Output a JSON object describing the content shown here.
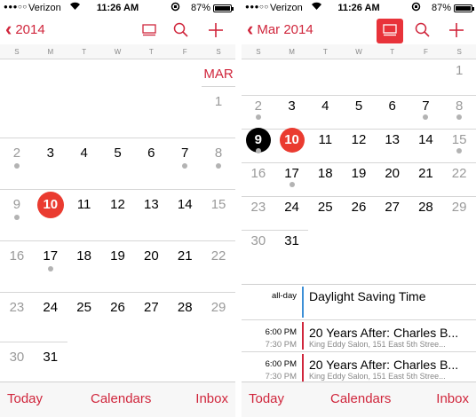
{
  "colors": {
    "accent": "#d0263c",
    "today": "#ea3b30",
    "selected": "#000000",
    "event_bar_blue": "#3d8fd6",
    "event_bar_red": "#d0263c"
  },
  "status_bar": {
    "carrier": "Verizon",
    "time": "11:26 AM",
    "battery": "87%",
    "battery_level": 0.87
  },
  "weekday_headers": [
    "S",
    "M",
    "T",
    "W",
    "T",
    "F",
    "S"
  ],
  "left": {
    "nav": {
      "back_label": "2014"
    },
    "month_marker": "MAR",
    "weeks": [
      [
        null,
        null,
        null,
        null,
        null,
        null,
        "1"
      ],
      [
        "2",
        "3",
        "4",
        "5",
        "6",
        "7",
        "8"
      ],
      [
        "9",
        "10",
        "11",
        "12",
        "13",
        "14",
        "15"
      ],
      [
        "16",
        "17",
        "18",
        "19",
        "20",
        "21",
        "22"
      ],
      [
        "23",
        "24",
        "25",
        "26",
        "27",
        "28",
        "29"
      ],
      [
        "30",
        "31",
        null,
        null,
        null,
        null,
        null
      ]
    ],
    "today": "10",
    "event_dots": [
      "2",
      "7",
      "8",
      "9",
      "17"
    ]
  },
  "right": {
    "nav": {
      "back_label": "Mar 2014"
    },
    "weeks": [
      [
        null,
        null,
        null,
        null,
        null,
        null,
        "1"
      ],
      [
        "2",
        "3",
        "4",
        "5",
        "6",
        "7",
        "8"
      ],
      [
        "9",
        "10",
        "11",
        "12",
        "13",
        "14",
        "15"
      ],
      [
        "16",
        "17",
        "18",
        "19",
        "20",
        "21",
        "22"
      ],
      [
        "23",
        "24",
        "25",
        "26",
        "27",
        "28",
        "29"
      ],
      [
        "30",
        "31",
        null,
        null,
        null,
        null,
        null
      ]
    ],
    "today": "10",
    "selected": "9",
    "event_dots": [
      "2",
      "7",
      "8",
      "9",
      "15",
      "17"
    ],
    "events": [
      {
        "start": "all-day",
        "end": "",
        "title": "Daylight Saving Time",
        "location": "",
        "bar": "blue"
      },
      {
        "start": "6:00 PM",
        "end": "7:30 PM",
        "title": "20 Years After: Charles B...",
        "location": "King Eddy Salon, 151 East 5th Stree...",
        "bar": "red"
      },
      {
        "start": "6:00 PM",
        "end": "7:30 PM",
        "title": "20 Years After: Charles B...",
        "location": "King Eddy Salon, 151 East 5th Stree...",
        "bar": "red"
      }
    ]
  },
  "toolbar": {
    "today_label": "Today",
    "calendars_label": "Calendars",
    "inbox_label": "Inbox"
  }
}
